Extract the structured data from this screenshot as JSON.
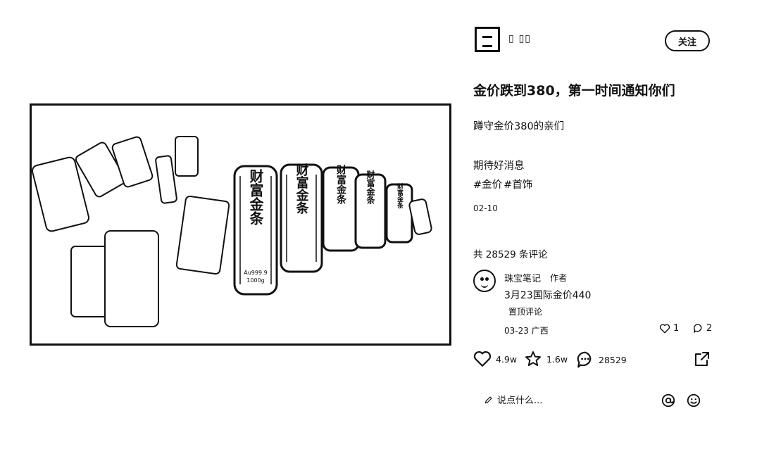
{
  "author": {
    "name": "▯ ▯▯",
    "follow_label": "关注"
  },
  "post": {
    "title": "金价跌到380，第一时间通知你们",
    "line1": "蹲守金价380的亲们",
    "line2": "期待好消息",
    "tags": [
      "#金价",
      "#首饰"
    ],
    "date": "02-10"
  },
  "image": {
    "bar_labels": [
      "财富金条",
      "财富金条",
      "财富金条",
      "财富金条",
      "财富金条"
    ],
    "bar_fine_print": "Au999.9",
    "bar_weight": "1000g"
  },
  "comments": {
    "count_text": "共 28529 条评论",
    "items": [
      {
        "author": "珠宝笔记",
        "badge": "作者",
        "text": "3月23国际金价440",
        "pinned_label": "置顶评论",
        "meta": "03-23 广西",
        "likes": "1",
        "replies": "2"
      }
    ]
  },
  "actions": {
    "likes": "4.9w",
    "favorites": "1.6w",
    "comments": "28529"
  },
  "input": {
    "placeholder": "说点什么..."
  },
  "icons": {
    "heart": "heart-icon",
    "star": "star-icon",
    "comment": "comment-bubble-icon",
    "share": "share-icon",
    "pencil": "pencil-icon",
    "at": "at-sign-icon",
    "emoji": "emoji-icon"
  }
}
